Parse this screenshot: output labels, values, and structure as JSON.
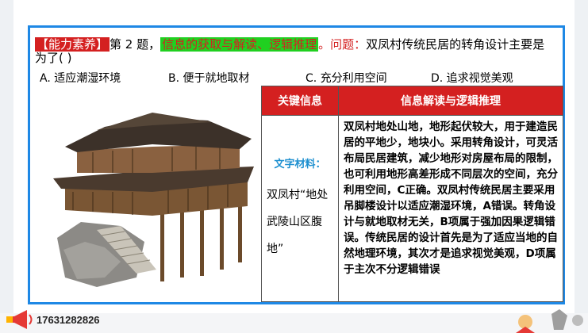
{
  "question": {
    "tag": "【能力素养】",
    "number": "第 2 题，",
    "skill": "信息的获取与解读、逻辑推理",
    "label": "。问题：",
    "text": "双凤村传统民居的转角设计主要是为了(    )"
  },
  "options": [
    {
      "text": "A. 适应潮湿环境"
    },
    {
      "text": "B. 便于就地取材"
    },
    {
      "text": "C. 充分利用空间"
    },
    {
      "text": "D. 追求视觉美观"
    }
  ],
  "table": {
    "header_left": "关键信息",
    "header_right": "信息解读与逻辑推理",
    "material_label": "文字材料：",
    "material_quote": "双凤村“地处武陵山区腹地”",
    "analysis": "双凤村地处山地，地形起伏较大，用于建造民居的平地少，地块小。采用转角设计，可灵活布局民居建筑，减少地形对房屋布局的限制，也可利用地形高差形成不同层次的空间，充分利用空间，C正确。双凤村传统民居主要采用吊脚楼设计以适应潮湿环境，A错误。转角设计与就地取材无关，B项属于强加因果逻辑错误。传统民居的设计首先是为了适应当地的自然地理环境，其次才是追求视觉美观，D项属于主次不分逻辑错误"
  },
  "footer": {
    "phone": "17631282826"
  },
  "colors": {
    "border_blue": "#1e88e5",
    "header_red": "#d42020",
    "tag_green": "#20d020",
    "label_blue": "#1e90d0"
  },
  "icons": [
    "megaphone-icon",
    "building-image",
    "decoration-figure"
  ]
}
